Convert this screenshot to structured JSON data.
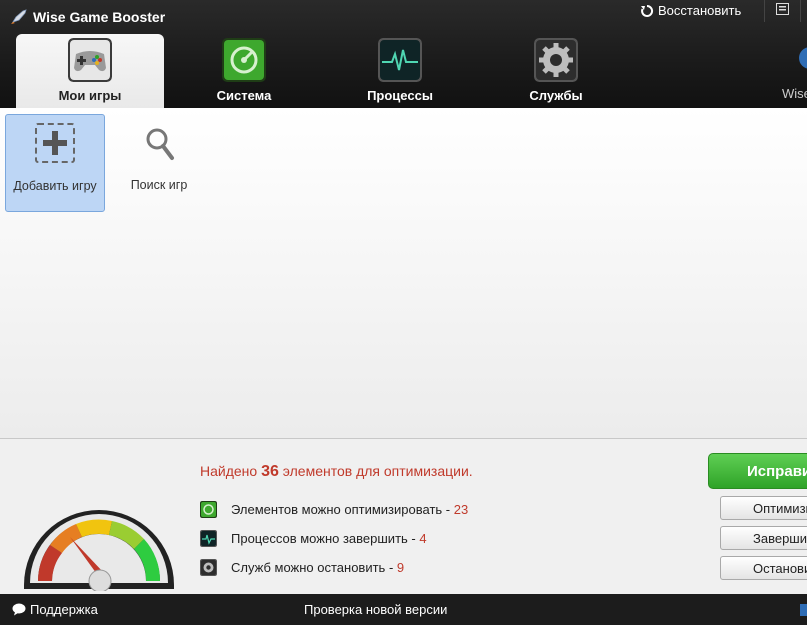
{
  "app": {
    "title": "Wise Game Booster",
    "restore_label": "Восстановить"
  },
  "tabs": [
    {
      "label": "Мои игры",
      "icon": "gamepad-icon",
      "active": true
    },
    {
      "label": "Система",
      "icon": "system-icon",
      "active": false
    },
    {
      "label": "Процессы",
      "icon": "processes-icon",
      "active": false
    },
    {
      "label": "Службы",
      "icon": "services-icon",
      "active": false
    }
  ],
  "side_label": "Wise",
  "content": {
    "add_game": "Добавить игру",
    "search_games": "Поиск игр"
  },
  "summary": {
    "found_prefix": "Найдено",
    "found_count": "36",
    "found_suffix": "элементов для оптимизации.",
    "items": [
      {
        "label": "Элементов можно оптимизировать - ",
        "value": "23",
        "icon": "system-icon",
        "button": "Оптимизировать"
      },
      {
        "label": "Процессов можно завершить - ",
        "value": "4",
        "icon": "processes-icon",
        "button": "Завершить"
      },
      {
        "label": "Служб можно остановить - ",
        "value": "9",
        "icon": "services-icon",
        "button": "Остановить"
      }
    ],
    "fix_button": "Исправить"
  },
  "statusbar": {
    "support": "Поддержка",
    "update": "Проверка новой версии"
  },
  "colors": {
    "accent_red": "#c03a2b",
    "green": "#3fb236",
    "selection_blue": "#bdd6f5"
  }
}
